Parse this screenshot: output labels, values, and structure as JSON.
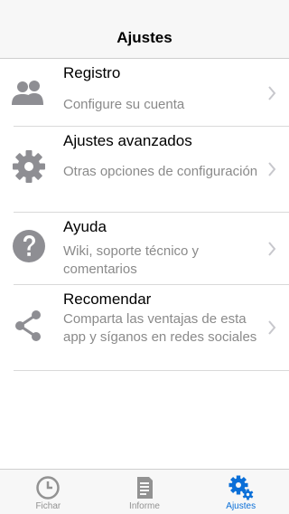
{
  "navbar": {
    "title": "Ajustes"
  },
  "settings": {
    "items": [
      {
        "label": "Registro",
        "description": "Configure su cuenta",
        "icon": "people-icon"
      },
      {
        "label": "Ajustes avanzados",
        "description": "Otras opciones de configuración",
        "icon": "gear-icon"
      },
      {
        "label": "Ayuda",
        "description": "Wiki, soporte técnico y comentarios",
        "icon": "help-icon"
      },
      {
        "label": "Recomendar",
        "description": "Comparta las ventajas de esta app y síganos en redes sociales",
        "icon": "share-icon"
      }
    ]
  },
  "tabbar": {
    "tabs": [
      {
        "label": "Fichar",
        "icon": "clock-icon",
        "active": false
      },
      {
        "label": "Informe",
        "icon": "document-icon",
        "active": false
      },
      {
        "label": "Ajustes",
        "icon": "gears-icon",
        "active": true
      }
    ]
  },
  "colors": {
    "accent": "#0a6fd8",
    "icon_gray": "#8e8e93",
    "chevron": "#c7c7cc"
  }
}
